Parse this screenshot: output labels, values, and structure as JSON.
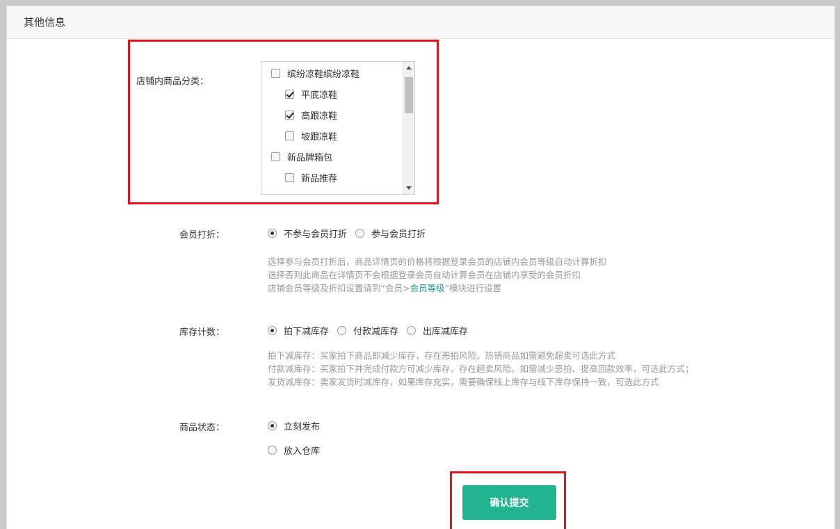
{
  "panel": {
    "title": "其他信息"
  },
  "category": {
    "label": "店铺内商品分类：",
    "items": [
      {
        "label": "缤纷凉鞋缤纷凉鞋",
        "checked": false,
        "level": 0
      },
      {
        "label": "平底凉鞋",
        "checked": true,
        "level": 1
      },
      {
        "label": "高跟凉鞋",
        "checked": true,
        "level": 1
      },
      {
        "label": "坡跟凉鞋",
        "checked": false,
        "level": 1
      },
      {
        "label": "新品牌箱包",
        "checked": false,
        "level": 0
      },
      {
        "label": "新品推荐",
        "checked": false,
        "level": 1
      }
    ]
  },
  "member_discount": {
    "label": "会员打折：",
    "options": [
      {
        "label": "不参与会员打折",
        "checked": true
      },
      {
        "label": "参与会员打折",
        "checked": false
      }
    ],
    "hints": [
      "选择参与会员打折后，商品详情页的价格将根据登录会员的店铺内会员等级自动计算折扣",
      "选择否则此商品在详情页不会根据登录会员自动计算会员在店铺内享受的会员折扣"
    ],
    "hint3_prefix": "店铺会员等级及折扣设置请到“会员>",
    "hint3_link": "会员等级",
    "hint3_suffix": "”模块进行设置"
  },
  "stock_count": {
    "label": "库存计数：",
    "options": [
      {
        "label": "拍下减库存",
        "checked": true
      },
      {
        "label": "付款减库存",
        "checked": false
      },
      {
        "label": "出库减库存",
        "checked": false
      }
    ],
    "hints": [
      "拍下减库存：买家拍下商品即减少库存，存在恶拍风险。热销商品如需避免超卖可选此方式",
      "付款减库存：买家拍下并完成付款方可减少库存，存在超卖风险。如需减少恶拍、提高回款效率，可选此方式；",
      "发货减库存：卖家发货时减库存，如果库存充实，需要确保线上库存与线下库存保持一致，可选此方式"
    ]
  },
  "product_status": {
    "label": "商品状态：",
    "options": [
      {
        "label": "立刻发布",
        "checked": true
      },
      {
        "label": "放入仓库",
        "checked": false
      }
    ]
  },
  "submit": {
    "label": "确认提交"
  },
  "colors": {
    "accent": "#22b491",
    "link": "#1aa094",
    "highlight": "#e8121c"
  }
}
